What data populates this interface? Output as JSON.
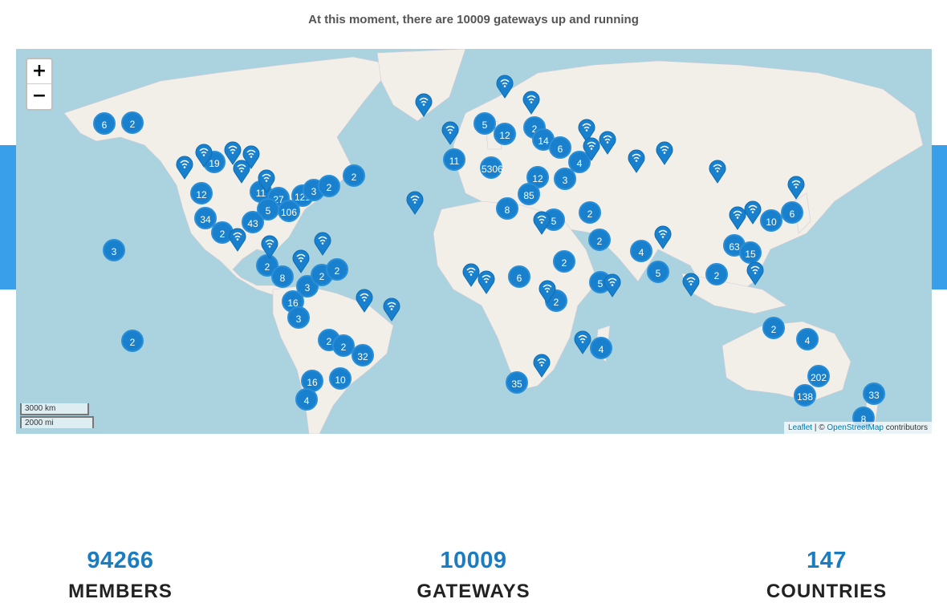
{
  "heading": "At this moment, there are 10009 gateways up and running",
  "map": {
    "zoom_in": "+",
    "zoom_out": "−",
    "scale_km": "3000 km",
    "scale_mi": "2000 mi",
    "attribution": {
      "leaflet": "Leaflet",
      "sep": " | © ",
      "osm": "OpenStreetMap",
      "suffix": " contributors"
    },
    "colors": {
      "water": "#aad3df",
      "land": "#f2efe9",
      "marker": "#1880cc"
    },
    "clusters": [
      "6",
      "2",
      "19",
      "12",
      "11",
      "27",
      "121",
      "3",
      "2",
      "2",
      "106",
      "5",
      "43",
      "34",
      "2",
      "3",
      "2",
      "2",
      "8",
      "3",
      "2",
      "16",
      "3",
      "2",
      "2",
      "2",
      "32",
      "16",
      "10",
      "4",
      "5306",
      "11",
      "5",
      "12",
      "2",
      "14",
      "6",
      "4",
      "12",
      "3",
      "85",
      "8",
      "2",
      "5",
      "2",
      "5",
      "2",
      "6",
      "2",
      "35",
      "4",
      "5",
      "10",
      "6",
      "4",
      "63",
      "15",
      "2",
      "2",
      "4",
      "202",
      "138",
      "33",
      "8"
    ],
    "pin_count": 36
  },
  "stats": [
    {
      "value": "94266",
      "label": "MEMBERS"
    },
    {
      "value": "10009",
      "label": "GATEWAYS"
    },
    {
      "value": "147",
      "label": "COUNTRIES"
    }
  ]
}
